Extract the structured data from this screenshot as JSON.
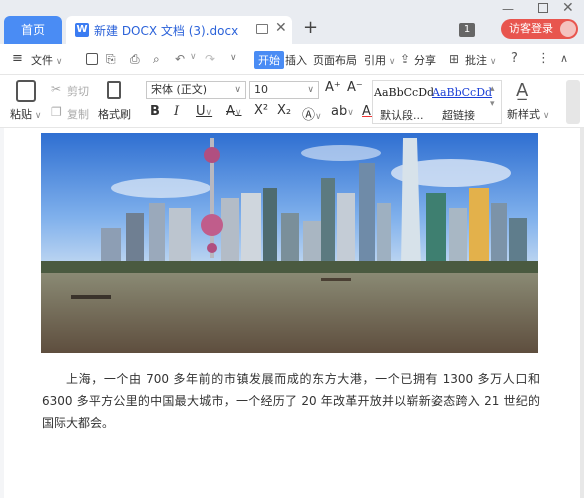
{
  "titlebar": {
    "home_tab": "首页",
    "doc_tab_title": "新建 DOCX 文档 (3).docx",
    "badge": "1",
    "login_label": "访客登录"
  },
  "menubar": {
    "file": "文件",
    "items": [
      "开始",
      "插入",
      "页面布局",
      "引用",
      "分享",
      "批注"
    ]
  },
  "ribbon": {
    "paste": "粘贴",
    "cut": "剪切",
    "copy": "复制",
    "format_painter": "格式刷",
    "font_name": "宋体 (正文)",
    "font_size": "10",
    "style1_preview": "AaBbCcDd",
    "style2_preview": "AaBbCcDd",
    "style1_label": "默认段...",
    "style2_label": "超链接",
    "new_style": "新样式"
  },
  "document": {
    "paragraph": "上海，一个由 700 多年前的市镇发展而成的东方大港，一个已拥有 1300 多万人口和 6300 多平方公里的中国最大城市，一个经历了 20 年改革开放并以崭新姿态跨入 21 世纪的国际大都会。"
  },
  "colors": {
    "accent": "#4a8cf4",
    "login_bg": "#e8554e",
    "link": "#2b62d9"
  }
}
